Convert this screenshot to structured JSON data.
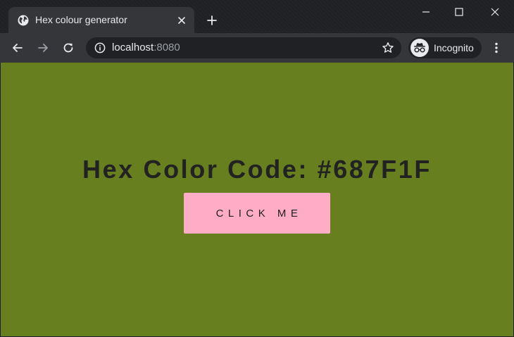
{
  "browser": {
    "tab": {
      "title": "Hex colour generator",
      "favicon": "globe-icon"
    },
    "omnibox": {
      "host": "localhost",
      "port": ":8080"
    },
    "profile": {
      "label": "Incognito",
      "icon": "incognito-icon"
    },
    "colors": {
      "frame": "#202124",
      "toolbar": "#35363a",
      "text": "#e8eaed"
    }
  },
  "page": {
    "background_color": "#687F1F",
    "heading": "Hex Color Code: #687F1F",
    "button_label": "CLICK ME",
    "button_color": "#ffadc6"
  }
}
